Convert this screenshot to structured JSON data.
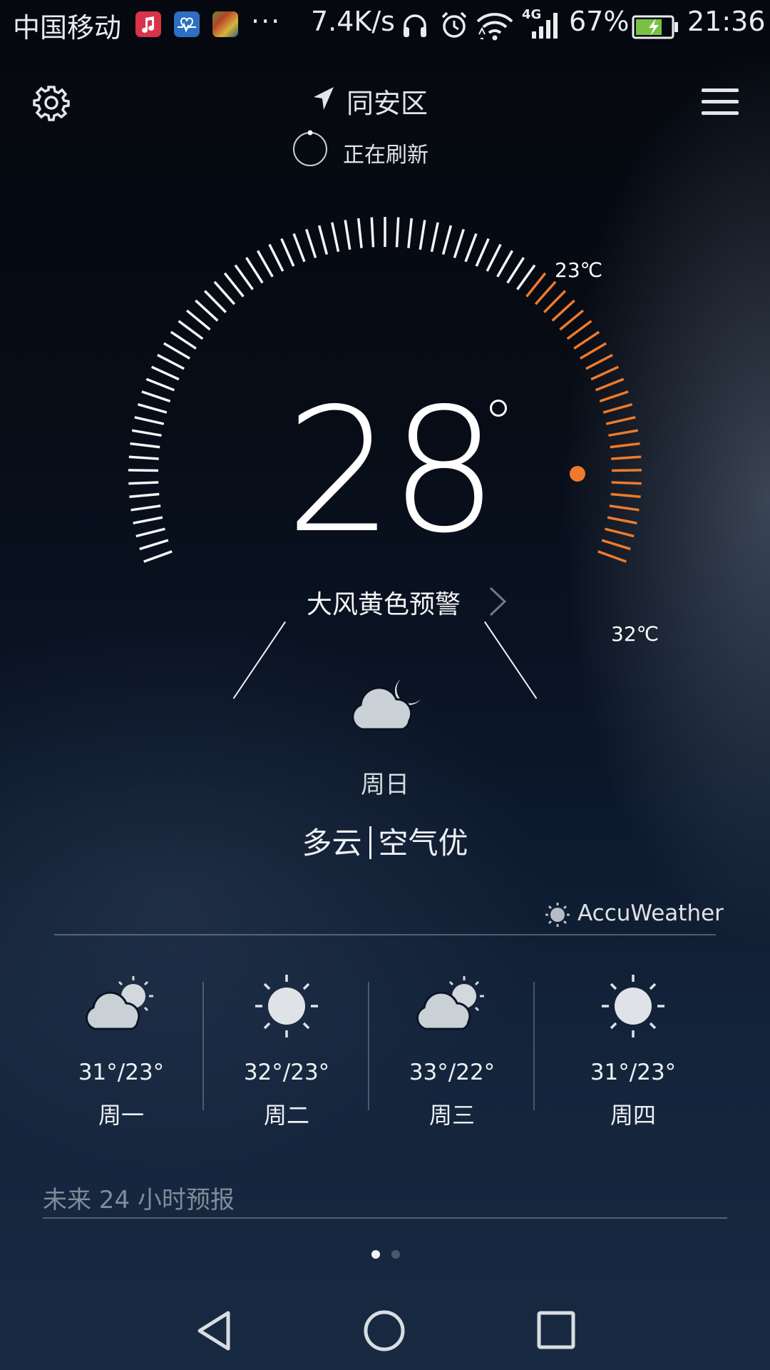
{
  "status_bar": {
    "carrier": "中国移动",
    "net_speed": "7.4K/s",
    "network_type": "4G",
    "battery": "67%",
    "time": "21:36",
    "more": "···",
    "icons": [
      "music-app-icon",
      "health-app-icon",
      "gallery-app-icon",
      "headphones-icon",
      "alarm-icon",
      "wifi-icon",
      "signal-icon",
      "battery-icon"
    ]
  },
  "header": {
    "location": "同安区",
    "refresh_status": "正在刷新",
    "icons": [
      "settings-gear-icon",
      "location-arrow-icon",
      "menu-icon",
      "refresh-spinner-icon"
    ]
  },
  "current": {
    "temperature": "28",
    "low_label": "23℃",
    "high_label": "32℃",
    "warning": "大风黄色预警",
    "weekday": "周日",
    "condition": "多云",
    "air_quality": "空气优",
    "condition_icon": "cloudy-night-icon",
    "accent_color": "#f07a2a"
  },
  "provider": {
    "name": "AccuWeather",
    "icon": "sun-icon"
  },
  "forecast": [
    {
      "day": "周一",
      "temps": "31°/23°",
      "icon": "partly-cloudy-icon"
    },
    {
      "day": "周二",
      "temps": "32°/23°",
      "icon": "sunny-icon"
    },
    {
      "day": "周三",
      "temps": "33°/22°",
      "icon": "partly-cloudy-icon"
    },
    {
      "day": "周四",
      "temps": "31°/23°",
      "icon": "sunny-icon"
    }
  ],
  "hourly": {
    "title": "未来 24 小时预报"
  },
  "pager": {
    "pages": 2,
    "active": 1
  },
  "nav_bar": {
    "icons": [
      "back-icon",
      "home-icon",
      "recents-icon"
    ]
  }
}
